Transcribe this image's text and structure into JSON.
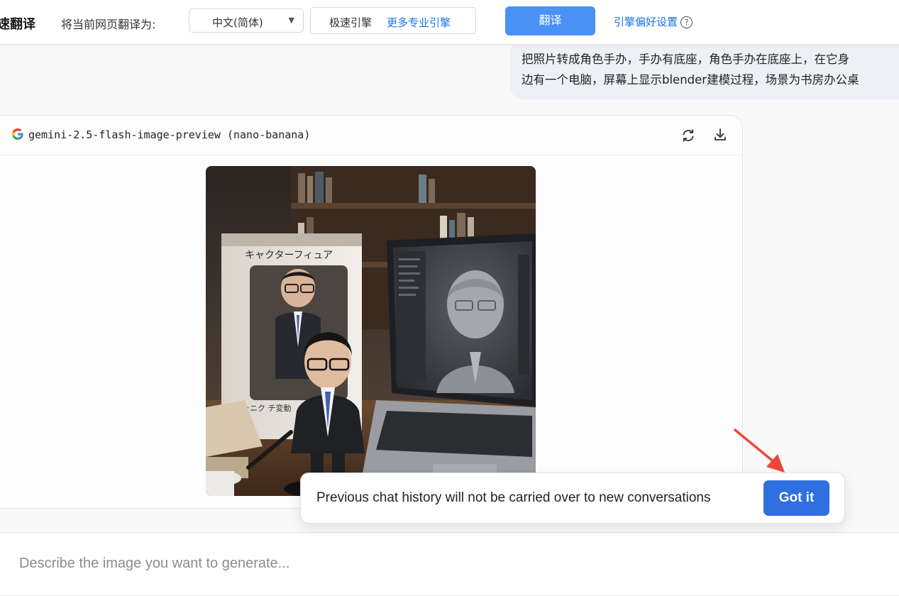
{
  "translate_bar": {
    "brand": "速翻译",
    "prompt": "将当前网页翻译为:",
    "language": "中文(简体)",
    "engine_current": "极速引擎",
    "engine_more": "更多专业引擎",
    "translate_button": "翻译",
    "preferences_link": "引擎偏好设置",
    "help_icon": "?"
  },
  "user_message": {
    "text": "把照片转成角色手办，手办有底座，角色手办在底座上，在它身\n边有一个电脑，屏幕上显示blender建模过程，场景为书房办公桌"
  },
  "response": {
    "model_name": "gemini-2.5-flash-image-preview (nano-banana)",
    "icons": [
      "google-logo-icon",
      "refresh-icon",
      "download-icon"
    ],
    "image": {
      "box_label": "キャクターフィュア",
      "box_bottom_label": "エッニク チ変動"
    }
  },
  "toast": {
    "message": "Previous chat history will not be carried over to new conversations",
    "button": "Got it"
  },
  "composer": {
    "placeholder": "Describe the image you want to generate..."
  },
  "colors": {
    "accent_blue": "#2f6fe0",
    "translate_button": "#4a90f5",
    "link_blue": "#1a73e8",
    "annotation_arrow": "#f0453a"
  }
}
